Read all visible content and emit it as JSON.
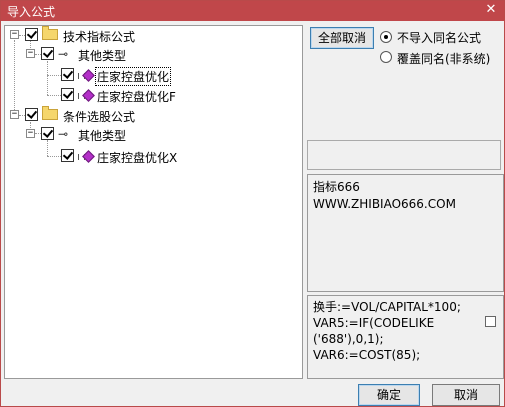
{
  "window": {
    "title": "导入公式",
    "close_glyph": "✕"
  },
  "tree": {
    "groups": [
      {
        "label": "技术指标公式",
        "sub": {
          "label": "其他类型",
          "items": [
            "庄家控盘优化",
            "庄家控盘优化F"
          ]
        }
      },
      {
        "label": "条件选股公式",
        "sub": {
          "label": "其他类型",
          "items": [
            "庄家控盘优化X"
          ]
        }
      }
    ],
    "selected_item": "庄家控盘优化",
    "expander_glyph": "−"
  },
  "options": {
    "deselect_all_label": "全部取消",
    "radio_skip_label": "不导入同名公式",
    "radio_overwrite_label": "覆盖同名(非系统)",
    "selected_radio": "skip"
  },
  "info": {
    "line1": "指标666",
    "line2": "WWW.ZHIBIAO666.COM"
  },
  "code": {
    "lines": [
      "换手:=VOL/CAPITAL*100;",
      "VAR5:=IF(CODELIKE",
      "('688'),0,1);",
      "VAR6:=COST(85);"
    ]
  },
  "footer": {
    "confirm_label": "确定",
    "cancel_label": "取消"
  },
  "colors": {
    "titlebar": "#c0474a",
    "folder": "#f5d66b",
    "formula_diamond": "#b32fc8"
  },
  "icons": {
    "folder": "folder-icon",
    "key": "key-icon",
    "formula": "formula-icon",
    "close": "close-icon"
  }
}
